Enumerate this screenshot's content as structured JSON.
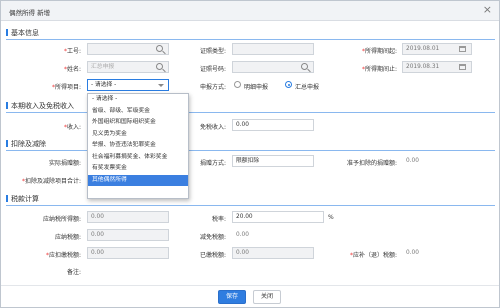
{
  "dialog": {
    "title": "偶然所得 新增",
    "close_label": "×"
  },
  "sections": {
    "basic": "基本信息",
    "income": "本期收入及免税收入",
    "deduct": "扣除及减除",
    "tax": "税款计算"
  },
  "basic": {
    "employee_id_label": "工号:",
    "employee_id_value": "",
    "name_label": "姓名:",
    "name_placeholder": "汇总申报",
    "item_label": "所得项目:",
    "item_value": "- 请选择 -",
    "cert_type_label": "证照类型:",
    "cert_type_value": "",
    "cert_no_label": "证照号码:",
    "cert_no_value": "",
    "filing_mode_label": "申报方式:",
    "filing_modes": [
      "明细申报",
      "汇总申报"
    ],
    "filing_mode_selected": "汇总申报",
    "period_start_label": "所得期间起:",
    "period_start_value": "2019.08.01",
    "period_end_label": "所得期间止:",
    "period_end_value": "2019.08.31"
  },
  "income": {
    "income_label": "收入:",
    "income_value": "",
    "exempt_label": "免税收入:",
    "exempt_value": "0.00"
  },
  "deduct": {
    "actual_donation_label": "实际捐赠额:",
    "actual_donation_value": "",
    "donation_mode_label": "捐赠方式:",
    "donation_mode_value": "限额扣除",
    "allowed_donation_label": "准予扣除的捐赠额:",
    "allowed_donation_value": "0.00",
    "total_label": "扣除及减除项目合计:",
    "total_value": ""
  },
  "tax": {
    "taxable_label": "应纳税所得额:",
    "taxable_value": "0.00",
    "rate_label": "税率:",
    "rate_value": "20.00",
    "rate_unit": "%",
    "payable_label": "应纳税额:",
    "payable_value": "0.00",
    "reduction_label": "减免税额:",
    "reduction_value": "0.00",
    "withhold_label": "应扣缴税额:",
    "withhold_value": "0.00",
    "paid_label": "已缴税额:",
    "paid_value": "0.00",
    "refund_label": "应补（退）税额:",
    "refund_value": "0.00",
    "remark_label": "备注:",
    "remark_value": ""
  },
  "dropdown": {
    "options": [
      "- 请选择 -",
      "省级、部级、军级奖金",
      "外国组织和国际组织奖金",
      "见义勇为奖金",
      "举报、协查违法犯罪奖金",
      "社会福利募捐奖金、体彩奖金",
      "有奖发票奖金",
      "其他偶然所得"
    ],
    "selected_index": 7
  },
  "buttons": {
    "save": "保存",
    "close": "关闭"
  },
  "colors": {
    "accent": "#2f7de0",
    "selected": "#3b7fe0",
    "required": "#ee3333"
  }
}
